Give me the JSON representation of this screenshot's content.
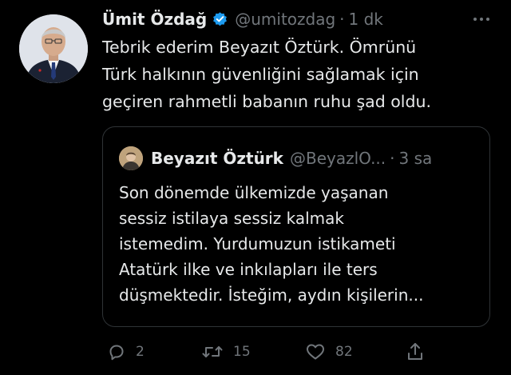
{
  "tweet": {
    "author": {
      "display_name": "Ümit Özdağ",
      "handle": "@umitozdag",
      "verified": true
    },
    "separator": "·",
    "time": "1 dk",
    "text_lines": [
      "Tebrik ederim Beyazıt Öztürk. Ömrünü",
      "Türk halkının güvenliğini sağlamak için",
      "geçiren rahmetli babanın ruhu şad oldu."
    ],
    "quote": {
      "display_name": "Beyazıt Öztürk",
      "handle": "@BeyazlO...",
      "separator": "·",
      "time": "3 sa",
      "text_lines": [
        "Son dönemde ülkemizde yaşanan",
        "sessiz istilaya sessiz kalmak",
        "istemedim. Yurdumuzun istikameti",
        "Atatürk ilke ve inkılapları ile ters",
        "düşmektedir. İsteğim, aydın kişilerin..."
      ]
    },
    "actions": {
      "reply": {
        "icon": "reply-icon",
        "count": "2"
      },
      "retweet": {
        "icon": "retweet-icon",
        "count": "15"
      },
      "like": {
        "icon": "heart-icon",
        "count": "82"
      },
      "share": {
        "icon": "share-icon"
      }
    }
  },
  "colors": {
    "background": "#000000",
    "primary_text": "#e7e9ea",
    "secondary_text": "#71767b",
    "border": "#2f3336",
    "verified_badge": "#1d9bf0"
  }
}
